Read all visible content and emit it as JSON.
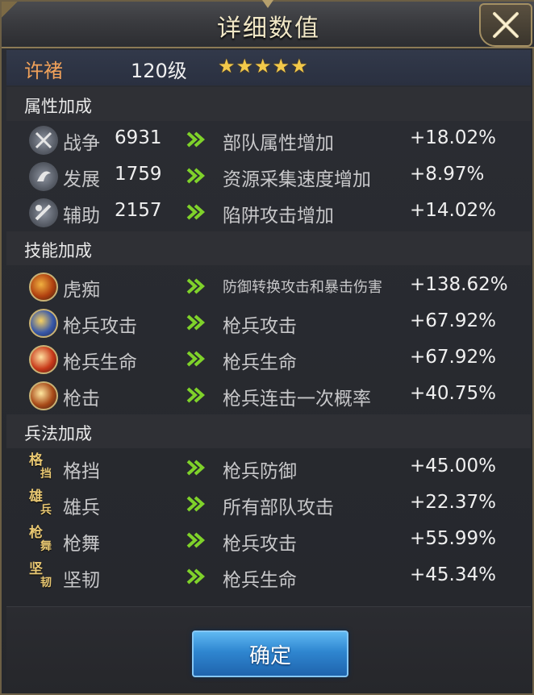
{
  "title": "详细数值",
  "hero": {
    "name": "许褚",
    "level": "120级",
    "stars": "★★★★★"
  },
  "sections": [
    {
      "label": "属性加成"
    },
    {
      "label": "技能加成"
    },
    {
      "label": "兵法加成"
    }
  ],
  "attributes": [
    {
      "icon": "crossed-swords-icon",
      "name": "战争",
      "value": "6931",
      "desc": "部队属性增加",
      "bonus": "+18.02%"
    },
    {
      "icon": "growth-icon",
      "name": "发展",
      "value": "1759",
      "desc": "资源采集速度增加",
      "bonus": "+8.97%"
    },
    {
      "icon": "support-icon",
      "name": "辅助",
      "value": "2157",
      "desc": "陷阱攻击增加",
      "bonus": "+14.02%"
    }
  ],
  "skills": [
    {
      "icon": "skill-huchi-icon",
      "name": "虎痴",
      "desc": "防御转换攻击和暴击伤害",
      "bonus": "+138.62%"
    },
    {
      "icon": "skill-spear-attack-icon",
      "name": "枪兵攻击",
      "desc": "枪兵攻击",
      "bonus": "+67.92%"
    },
    {
      "icon": "skill-spear-life-icon",
      "name": "枪兵生命",
      "desc": "枪兵生命",
      "bonus": "+67.92%"
    },
    {
      "icon": "skill-spear-strike-icon",
      "name": "枪击",
      "desc": "枪兵连击一次概率",
      "bonus": "+40.75%"
    }
  ],
  "tactics": [
    {
      "glyph1": "格",
      "glyph2": "挡",
      "name": "格挡",
      "desc": "枪兵防御",
      "bonus": "+45.00%"
    },
    {
      "glyph1": "雄",
      "glyph2": "兵",
      "name": "雄兵",
      "desc": "所有部队攻击",
      "bonus": "+22.37%"
    },
    {
      "glyph1": "枪",
      "glyph2": "舞",
      "name": "枪舞",
      "desc": "枪兵攻击",
      "bonus": "+55.99%"
    },
    {
      "glyph1": "坚",
      "glyph2": "韧",
      "name": "坚韧",
      "desc": "枪兵生命",
      "bonus": "+45.34%"
    }
  ],
  "confirm_label": "确定",
  "colors": {
    "hero_name": "#f0a15a",
    "stars": "#f3c94a",
    "arrow": "#7fd22a",
    "button": "#2f86d0"
  }
}
